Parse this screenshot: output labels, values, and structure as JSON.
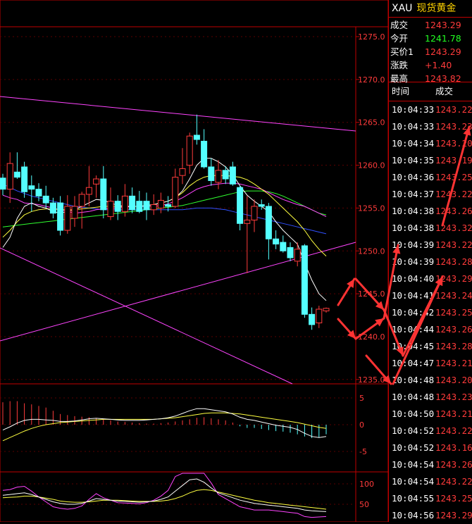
{
  "header": {
    "symbol": "XAU",
    "name": "现货黄金"
  },
  "quotes": [
    {
      "label": "成交",
      "value": "1243.29",
      "color": "#ff3b3b"
    },
    {
      "label": "今开",
      "value": "1241.78",
      "color": "#22ff22"
    },
    {
      "label": "买价1",
      "value": "1243.29",
      "color": "#ff3b3b"
    },
    {
      "label": "涨跌",
      "value": "+1.40",
      "color": "#ff3b3b"
    },
    {
      "label": "最高",
      "value": "1243.82",
      "color": "#ff3b3b"
    }
  ],
  "ticks_header": {
    "time": "时间",
    "price": "成交"
  },
  "ticks": [
    {
      "time": "10:04:33",
      "price": "1243.22"
    },
    {
      "time": "10:04:33",
      "price": "1243.23"
    },
    {
      "time": "10:04:34",
      "price": "1243.20"
    },
    {
      "time": "10:04:35",
      "price": "1243.19"
    },
    {
      "time": "10:04:36",
      "price": "1243.25"
    },
    {
      "time": "10:04:37",
      "price": "1243.22"
    },
    {
      "time": "10:04:38",
      "price": "1243.26"
    },
    {
      "time": "10:04:38",
      "price": "1243.32"
    },
    {
      "time": "10:04:39",
      "price": "1243.22"
    },
    {
      "time": "10:04:39",
      "price": "1243.28"
    },
    {
      "time": "10:04:40",
      "price": "1243.29"
    },
    {
      "time": "10:04:41",
      "price": "1243.24"
    },
    {
      "time": "10:04:42",
      "price": "1243.25"
    },
    {
      "time": "10:04:44",
      "price": "1243.26"
    },
    {
      "time": "10:04:45",
      "price": "1243.28"
    },
    {
      "time": "10:04:47",
      "price": "1243.21"
    },
    {
      "time": "10:04:48",
      "price": "1243.20"
    },
    {
      "time": "10:04:48",
      "price": "1243.23"
    },
    {
      "time": "10:04:50",
      "price": "1243.21"
    },
    {
      "time": "10:04:52",
      "price": "1243.22"
    },
    {
      "time": "10:04:52",
      "price": "1243.16"
    },
    {
      "time": "10:04:54",
      "price": "1243.26"
    },
    {
      "time": "10:04:54",
      "price": "1243.22"
    },
    {
      "time": "10:04:55",
      "price": "1243.25"
    },
    {
      "time": "10:04:56",
      "price": "1243.29"
    }
  ],
  "price_axis": {
    "min": 1235.0,
    "max": 1275.0,
    "labels": [
      "1275.0",
      "1270.0",
      "1265.0",
      "1260.0",
      "1255.0",
      "1250.0",
      "1245.0",
      "1240.0",
      "1235.0"
    ],
    "values": [
      1275,
      1270,
      1265,
      1260,
      1255,
      1250,
      1245,
      1240,
      1235
    ]
  },
  "macd_axis": {
    "labels": [
      "5",
      "0",
      "-5"
    ],
    "values": [
      5,
      0,
      -5
    ]
  },
  "kdj_axis": {
    "labels": [
      "100",
      "50"
    ],
    "values": [
      100,
      50
    ]
  },
  "colors": {
    "up": "#ff3b3b",
    "down": "#54ffff",
    "grid": "#c00000",
    "text": "#ff3b3b"
  },
  "candles": [
    {
      "o": 1258.5,
      "h": 1259.0,
      "l": 1256.5,
      "c": 1257.2
    },
    {
      "o": 1257.2,
      "h": 1261.5,
      "l": 1255.6,
      "c": 1260.2
    },
    {
      "o": 1259.2,
      "h": 1261.5,
      "l": 1258.4,
      "c": 1258.6
    },
    {
      "o": 1259.8,
      "h": 1260.4,
      "l": 1256.2,
      "c": 1256.9
    },
    {
      "o": 1257.6,
      "h": 1258.8,
      "l": 1254.6,
      "c": 1257.2
    },
    {
      "o": 1257.2,
      "h": 1257.9,
      "l": 1255.8,
      "c": 1256.4
    },
    {
      "o": 1256.4,
      "h": 1257.6,
      "l": 1255.0,
      "c": 1255.6
    },
    {
      "o": 1255.6,
      "h": 1256.2,
      "l": 1253.8,
      "c": 1254.4
    },
    {
      "o": 1255.6,
      "h": 1256.4,
      "l": 1251.8,
      "c": 1252.4
    },
    {
      "o": 1252.4,
      "h": 1256.5,
      "l": 1252.0,
      "c": 1255.2
    },
    {
      "o": 1253.8,
      "h": 1256.4,
      "l": 1252.8,
      "c": 1255.2
    },
    {
      "o": 1255.2,
      "h": 1256.9,
      "l": 1252.6,
      "c": 1256.6
    },
    {
      "o": 1256.6,
      "h": 1259.9,
      "l": 1255.2,
      "c": 1257.4
    },
    {
      "o": 1257.8,
      "h": 1258.8,
      "l": 1256.2,
      "c": 1258.4
    },
    {
      "o": 1258.4,
      "h": 1259.9,
      "l": 1253.8,
      "c": 1254.8
    },
    {
      "o": 1254.0,
      "h": 1257.4,
      "l": 1253.6,
      "c": 1255.8
    },
    {
      "o": 1255.8,
      "h": 1256.5,
      "l": 1253.6,
      "c": 1254.6
    },
    {
      "o": 1254.6,
      "h": 1257.8,
      "l": 1254.0,
      "c": 1256.4
    },
    {
      "o": 1256.4,
      "h": 1257.4,
      "l": 1254.4,
      "c": 1254.8
    },
    {
      "o": 1255.8,
      "h": 1257.0,
      "l": 1254.4,
      "c": 1254.6
    },
    {
      "o": 1255.8,
      "h": 1256.8,
      "l": 1253.6,
      "c": 1254.8
    },
    {
      "o": 1254.8,
      "h": 1256.6,
      "l": 1254.2,
      "c": 1255.4
    },
    {
      "o": 1255.0,
      "h": 1256.8,
      "l": 1254.4,
      "c": 1255.9
    },
    {
      "o": 1255.4,
      "h": 1256.4,
      "l": 1254.6,
      "c": 1255.2
    },
    {
      "o": 1255.2,
      "h": 1259.6,
      "l": 1255.0,
      "c": 1258.6
    },
    {
      "o": 1258.8,
      "h": 1262.0,
      "l": 1257.8,
      "c": 1259.6
    },
    {
      "o": 1260.0,
      "h": 1263.8,
      "l": 1259.0,
      "c": 1263.4
    },
    {
      "o": 1263.5,
      "h": 1265.9,
      "l": 1262.4,
      "c": 1263.0
    },
    {
      "o": 1262.8,
      "h": 1264.2,
      "l": 1259.6,
      "c": 1259.8
    },
    {
      "o": 1259.8,
      "h": 1260.8,
      "l": 1257.6,
      "c": 1258.2
    },
    {
      "o": 1258.0,
      "h": 1260.6,
      "l": 1257.2,
      "c": 1259.4
    },
    {
      "o": 1259.4,
      "h": 1259.9,
      "l": 1257.8,
      "c": 1258.4
    },
    {
      "o": 1259.8,
      "h": 1260.4,
      "l": 1257.6,
      "c": 1257.8
    },
    {
      "o": 1257.4,
      "h": 1257.6,
      "l": 1252.4,
      "c": 1253.2
    },
    {
      "o": 1253.2,
      "h": 1256.4,
      "l": 1247.4,
      "c": 1253.6
    },
    {
      "o": 1253.6,
      "h": 1256.0,
      "l": 1252.2,
      "c": 1255.2
    },
    {
      "o": 1255.4,
      "h": 1256.0,
      "l": 1254.8,
      "c": 1255.2
    },
    {
      "o": 1255.2,
      "h": 1255.6,
      "l": 1249.0,
      "c": 1251.4
    },
    {
      "o": 1251.4,
      "h": 1252.4,
      "l": 1250.2,
      "c": 1250.8
    },
    {
      "o": 1251.0,
      "h": 1251.8,
      "l": 1249.8,
      "c": 1250.0
    },
    {
      "o": 1250.4,
      "h": 1251.0,
      "l": 1248.8,
      "c": 1249.2
    },
    {
      "o": 1248.8,
      "h": 1251.0,
      "l": 1248.2,
      "c": 1250.2
    },
    {
      "o": 1250.6,
      "h": 1250.8,
      "l": 1242.2,
      "c": 1242.6
    },
    {
      "o": 1242.6,
      "h": 1243.4,
      "l": 1240.8,
      "c": 1241.4
    },
    {
      "o": 1241.6,
      "h": 1243.6,
      "l": 1241.0,
      "c": 1243.2
    },
    {
      "o": 1243.0,
      "h": 1243.4,
      "l": 1242.8,
      "c": 1243.3
    }
  ],
  "ma_white": [
    1250.4,
    1251.6,
    1253.8,
    1255.2,
    1255.6,
    1255.2,
    1255.0,
    1254.6,
    1254.4,
    1254.6,
    1254.8,
    1255.2,
    1255.6,
    1256.0,
    1255.9,
    1255.6,
    1255.3,
    1255.2,
    1255.2,
    1255.2,
    1255.3,
    1255.4,
    1255.6,
    1255.8,
    1256.2,
    1257.0,
    1258.4,
    1260.0,
    1260.8,
    1260.8,
    1260.4,
    1259.8,
    1258.9,
    1257.6,
    1256.5,
    1255.8,
    1255.2,
    1254.6,
    1253.4,
    1252.4,
    1251.6,
    1250.8,
    1248.6,
    1246.6,
    1245.0,
    1244.2
  ],
  "ma_yellow": [
    1251.6,
    1252.4,
    1253.4,
    1254.2,
    1254.6,
    1254.8,
    1254.9,
    1254.9,
    1254.8,
    1254.8,
    1254.8,
    1254.9,
    1255.0,
    1255.1,
    1255.2,
    1255.2,
    1255.2,
    1255.2,
    1255.2,
    1255.2,
    1255.3,
    1255.4,
    1255.6,
    1255.8,
    1256.2,
    1256.8,
    1257.6,
    1258.2,
    1258.6,
    1258.8,
    1258.8,
    1258.8,
    1258.7,
    1258.6,
    1258.3,
    1257.8,
    1257.2,
    1256.6,
    1255.8,
    1255.0,
    1254.2,
    1253.4,
    1252.4,
    1251.2,
    1250.2,
    1249.4
  ],
  "ma_magenta": [
    1256.5,
    1256.2,
    1256.0,
    1255.6,
    1255.5,
    1255.4,
    1255.2,
    1255.0,
    1254.8,
    1254.6,
    1254.4,
    1254.5,
    1254.6,
    1254.8,
    1254.9,
    1255.0,
    1255.0,
    1255.1,
    1255.2,
    1255.2,
    1255.2,
    1255.2,
    1255.3,
    1255.5,
    1255.8,
    1256.2,
    1256.7,
    1257.2,
    1257.5,
    1257.7,
    1257.8,
    1257.9,
    1257.9,
    1257.8,
    1257.6,
    1257.4,
    1257.2,
    1256.8,
    1256.4,
    1256.0,
    1255.7,
    1255.4,
    1255.2,
    1254.8,
    1254.4,
    1254.0
  ],
  "ma_green": [
    1252.8,
    1252.9,
    1253.0,
    1253.1,
    1253.2,
    1253.3,
    1253.4,
    1253.5,
    1253.6,
    1253.7,
    1253.8,
    1253.9,
    1254.0,
    1254.1,
    1254.2,
    1254.3,
    1254.4,
    1254.5,
    1254.6,
    1254.7,
    1254.8,
    1254.9,
    1255.0,
    1255.1,
    1255.2,
    1255.3,
    1255.5,
    1255.7,
    1255.9,
    1256.1,
    1256.3,
    1256.5,
    1256.7,
    1256.9,
    1257.0,
    1257.0,
    1257.0,
    1256.9,
    1256.7,
    1256.4,
    1256.0,
    1255.6,
    1255.2,
    1254.8,
    1254.4,
    1254.2
  ],
  "ma_blue": [
    1257.8,
    1257.4,
    1257.0,
    1256.7,
    1256.4,
    1256.2,
    1256.0,
    1255.8,
    1255.6,
    1255.4,
    1255.2,
    1255.1,
    1255.0,
    1254.9,
    1254.8,
    1254.8,
    1254.8,
    1254.8,
    1254.8,
    1254.8,
    1254.8,
    1254.8,
    1254.8,
    1254.8,
    1254.8,
    1254.8,
    1254.9,
    1255.0,
    1255.0,
    1255.0,
    1254.9,
    1254.8,
    1254.6,
    1254.4,
    1254.2,
    1254.0,
    1253.8,
    1253.6,
    1253.4,
    1253.2,
    1253.0,
    1252.8,
    1252.6,
    1252.4,
    1252.2,
    1252.0
  ],
  "macd_hist": [
    4.2,
    4.4,
    4.4,
    4.0,
    3.8,
    3.5,
    3.2,
    2.6,
    2.0,
    1.8,
    1.6,
    1.5,
    1.4,
    1.2,
    1.0,
    0.8,
    0.6,
    0.5,
    0.4,
    0.3,
    0.2,
    0.2,
    0.3,
    0.4,
    0.6,
    0.8,
    1.0,
    1.3,
    1.4,
    1.2,
    1.0,
    0.8,
    0.4,
    -0.3,
    -0.6,
    -0.6,
    -0.8,
    -1.0,
    -1.2,
    -1.3,
    -1.5,
    -1.8,
    -2.2,
    -2.5,
    -2.4,
    -1.8
  ],
  "macd_dif": [
    -1.0,
    -0.4,
    0.3,
    0.8,
    1.0,
    1.0,
    0.9,
    0.8,
    0.6,
    0.6,
    0.7,
    0.9,
    1.1,
    1.2,
    1.1,
    1.0,
    0.9,
    0.8,
    0.8,
    0.8,
    0.9,
    1.0,
    1.1,
    1.3,
    1.6,
    2.1,
    2.6,
    3.0,
    3.0,
    2.8,
    2.6,
    2.4,
    2.0,
    1.4,
    1.0,
    0.8,
    0.5,
    0.2,
    -0.1,
    -0.3,
    -0.5,
    -0.9,
    -1.6,
    -2.2,
    -2.4,
    -2.2
  ],
  "macd_dea": [
    -3.0,
    -2.4,
    -1.8,
    -1.2,
    -0.7,
    -0.3,
    0.0,
    0.2,
    0.4,
    0.5,
    0.6,
    0.7,
    0.8,
    0.9,
    1.0,
    1.0,
    1.0,
    1.0,
    1.0,
    1.0,
    1.0,
    1.0,
    1.1,
    1.2,
    1.3,
    1.5,
    1.7,
    1.9,
    2.1,
    2.2,
    2.2,
    2.2,
    2.1,
    2.0,
    1.8,
    1.6,
    1.4,
    1.2,
    1.0,
    0.8,
    0.6,
    0.4,
    0.1,
    -0.2,
    -0.5,
    -0.7
  ],
  "kdj_k": [
    72,
    74,
    76,
    78,
    74,
    68,
    62,
    56,
    52,
    50,
    50,
    52,
    58,
    64,
    62,
    60,
    58,
    57,
    56,
    55,
    56,
    58,
    62,
    68,
    82,
    96,
    110,
    112,
    104,
    90,
    78,
    72,
    66,
    60,
    56,
    52,
    50,
    48,
    46,
    44,
    42,
    40,
    36,
    34,
    33,
    32
  ],
  "kdj_d": [
    66,
    67,
    68,
    70,
    70,
    68,
    65,
    62,
    58,
    56,
    55,
    55,
    56,
    58,
    60,
    60,
    60,
    59,
    58,
    57,
    57,
    57,
    58,
    60,
    64,
    70,
    78,
    84,
    86,
    84,
    80,
    76,
    72,
    68,
    64,
    60,
    57,
    54,
    52,
    50,
    48,
    46,
    44,
    42,
    40,
    38
  ],
  "kdj_j": [
    84,
    86,
    92,
    94,
    82,
    68,
    56,
    44,
    40,
    38,
    40,
    46,
    62,
    76,
    66,
    60,
    54,
    53,
    52,
    51,
    54,
    60,
    70,
    84,
    118,
    148,
    154,
    148,
    140,
    102,
    74,
    64,
    54,
    44,
    40,
    36,
    36,
    36,
    34,
    32,
    30,
    28,
    20,
    18,
    19,
    20
  ]
}
